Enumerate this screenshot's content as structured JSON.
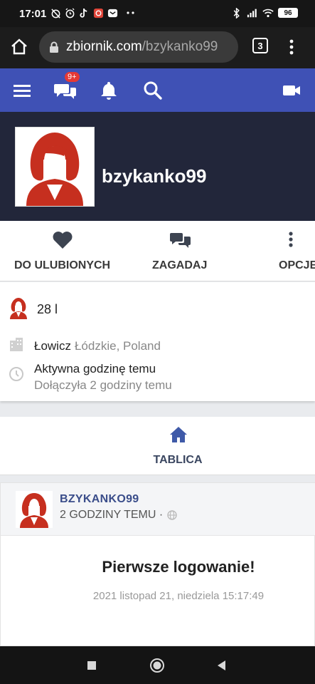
{
  "status_bar": {
    "time": "17:01",
    "battery": "96",
    "icons_left": [
      "alarm-off-icon",
      "alarm-icon",
      "tiktok-icon",
      "app-icon",
      "mail-icon",
      "more-dots-icon"
    ],
    "icons_right": [
      "bluetooth-icon",
      "signal-icon",
      "wifi-icon",
      "battery-icon"
    ]
  },
  "browser": {
    "url_host": "zbiornik.com",
    "url_path": "/bzykanko99",
    "tab_count": "3"
  },
  "site_nav": {
    "badge": "9+"
  },
  "profile": {
    "username": "bzykanko99"
  },
  "actions": [
    {
      "label": "DO ULUBIONYCH"
    },
    {
      "label": "ZAGADAJ"
    },
    {
      "label": "OPCJE"
    }
  ],
  "info": {
    "age": "28 l",
    "city": "Łowicz",
    "region": "Łódzkie, Poland",
    "active": "Aktywna godzinę temu",
    "joined": "Dołączyła 2 godziny temu"
  },
  "tab": {
    "label": "TABLICA"
  },
  "post": {
    "author": "BZYKANKO99",
    "time": "2 GODZINY TEMU ·",
    "title": "Pierwsze logowanie!",
    "date": "2021 listopad 21, niedziela 15:17:49"
  },
  "colors": {
    "nav_blue": "#3f51b5",
    "header_dark": "#22263a",
    "avatar_red": "#c62f1f",
    "badge_red": "#e53935"
  }
}
